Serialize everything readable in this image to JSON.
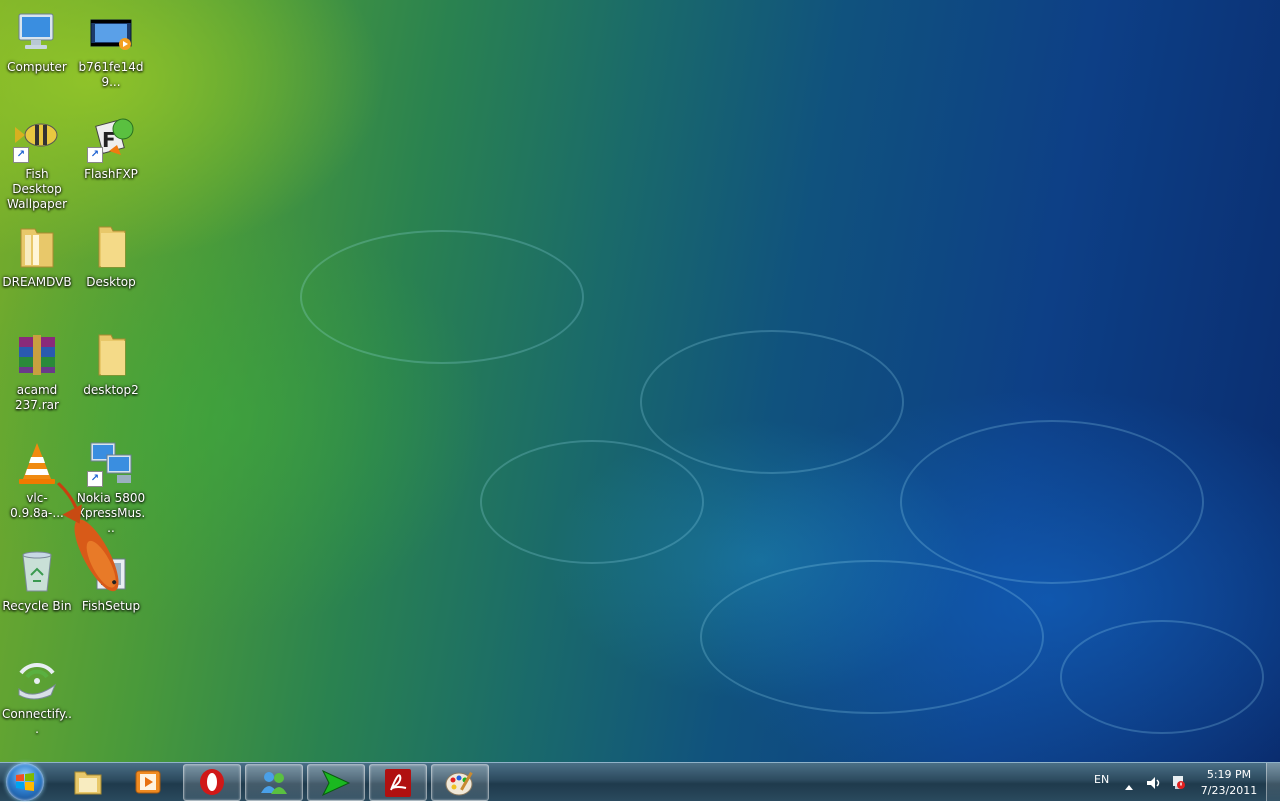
{
  "desktop": {
    "icons": [
      {
        "label": "Computer",
        "icon": "computer-icon"
      },
      {
        "label": "b761fe14d9...",
        "icon": "video-file-icon"
      },
      {
        "label": "Fish Desktop Wallpaper",
        "icon": "fish-shortcut-icon"
      },
      {
        "label": "FlashFXP",
        "icon": "flashfxp-icon"
      },
      {
        "label": "DREAMDVB",
        "icon": "folder-icon"
      },
      {
        "label": "Desktop",
        "icon": "folder-icon"
      },
      {
        "label": "acamd 237.rar",
        "icon": "winrar-archive-icon"
      },
      {
        "label": "desktop2",
        "icon": "folder-icon"
      },
      {
        "label": "vlc-0.9.8a-...",
        "icon": "vlc-icon"
      },
      {
        "label": "Nokia 5800 XpressMus...",
        "icon": "network-pc-icon"
      },
      {
        "label": "Recycle Bin",
        "icon": "recycle-bin-icon"
      },
      {
        "label": "FishSetup",
        "icon": "setup-icon"
      },
      {
        "label": "Connectify...",
        "icon": "connectify-icon"
      }
    ]
  },
  "taskbar": {
    "start_icon": "windows-orb-icon",
    "buttons": [
      {
        "name": "windows-explorer",
        "icon": "folders-icon",
        "state": "pinned"
      },
      {
        "name": "media-player",
        "icon": "media-player-icon",
        "state": "pinned"
      },
      {
        "name": "opera",
        "icon": "opera-icon",
        "state": "running"
      },
      {
        "name": "messenger",
        "icon": "messenger-icon",
        "state": "running"
      },
      {
        "name": "download-manager",
        "icon": "green-arrow-icon",
        "state": "running"
      },
      {
        "name": "adobe-reader",
        "icon": "adobe-reader-icon",
        "state": "running"
      },
      {
        "name": "paint",
        "icon": "paint-palette-icon",
        "state": "running"
      }
    ],
    "tray": {
      "language": "EN",
      "time": "5:19 PM",
      "date": "7/23/2011"
    }
  },
  "colors": {
    "wallpaper_green": "#7aae2a",
    "wallpaper_blue": "#0d3f86",
    "taskbar": "#2c4a5e",
    "opera_red": "#d01818",
    "adobe_red": "#b01010"
  }
}
